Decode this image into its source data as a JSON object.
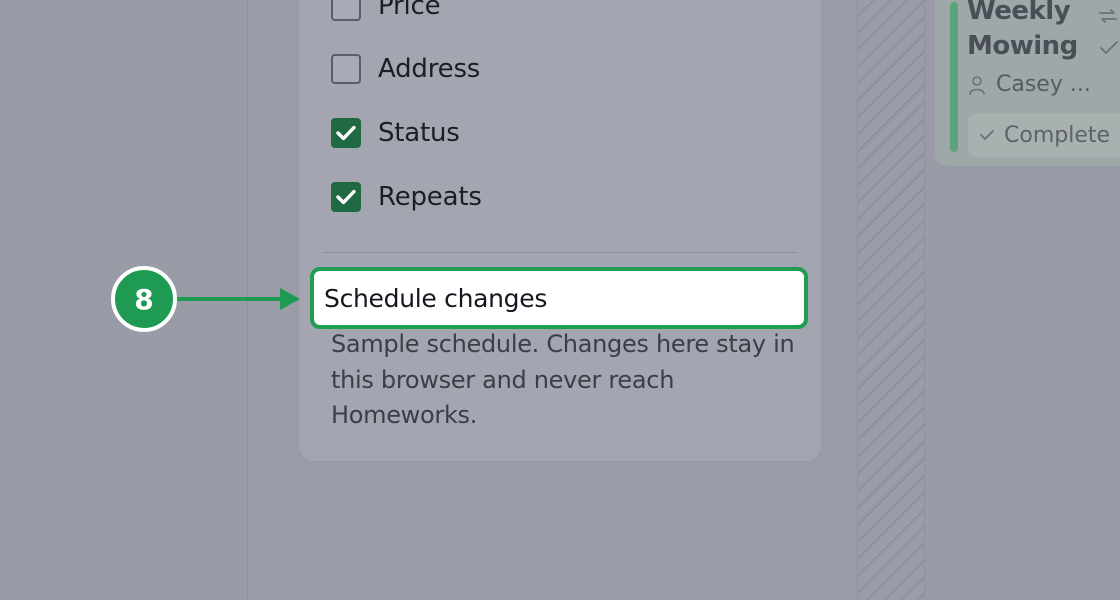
{
  "fields": {
    "items": [
      {
        "label": "Price",
        "checked": false
      },
      {
        "label": "Address",
        "checked": false
      },
      {
        "label": "Status",
        "checked": true
      },
      {
        "label": "Repeats",
        "checked": true
      }
    ]
  },
  "schedule": {
    "title": "Schedule changes",
    "description": "Sample schedule. Changes here stay in this browser and never reach Homeworks."
  },
  "tour": {
    "step": "8"
  },
  "card": {
    "title": "Weekly Mowing",
    "assignee": "Casey ...",
    "status": "Complete"
  },
  "colors": {
    "accent": "#1e9a53",
    "checkbox_checked": "#1f6a43",
    "card_bar": "#5fa37d"
  }
}
